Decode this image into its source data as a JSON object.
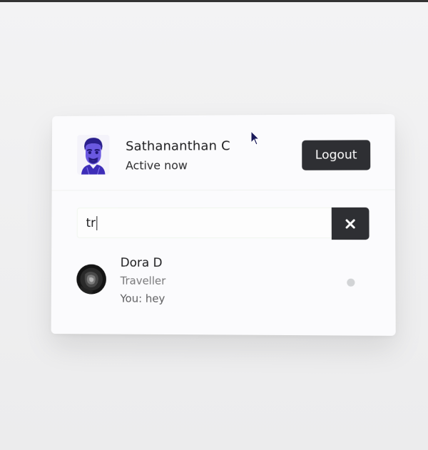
{
  "current_user": {
    "name": "Sathananthan C",
    "status": "Active now",
    "avatar_icon": "user-avatar-illustration"
  },
  "header": {
    "logout_label": "Logout"
  },
  "search": {
    "value": "tr",
    "clear_icon": "close-icon"
  },
  "chats": [
    {
      "name": "Dora D",
      "about": "Traveller",
      "last_message": "You: hey",
      "status": "offline",
      "status_color": "#d2d4d6"
    }
  ],
  "colors": {
    "button_bg": "#2e2f33",
    "avatar_accent": "#4a35c8",
    "card_bg": "#fbfbfd"
  }
}
